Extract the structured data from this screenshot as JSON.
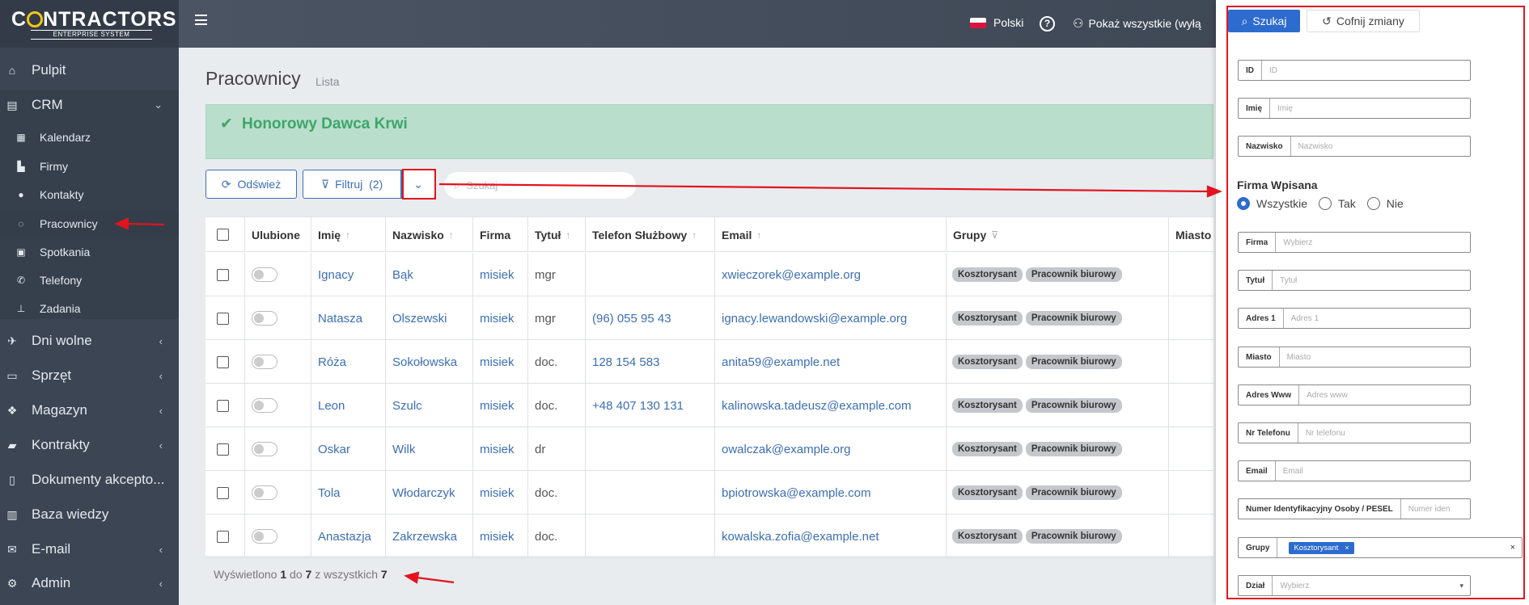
{
  "brand": {
    "name_pre": "C",
    "name_post": "NTRACTORS",
    "subtitle": "ENTERPRISE SYSTEM"
  },
  "sidebar": {
    "items": [
      {
        "label": "Pulpit",
        "icon": "home-icon"
      },
      {
        "label": "CRM",
        "icon": "address-card-icon",
        "arrow": "⌄"
      },
      {
        "label": "Dni wolne",
        "icon": "plane-icon",
        "arrow": "‹"
      },
      {
        "label": "Sprzęt",
        "icon": "hdd-icon",
        "arrow": "‹"
      },
      {
        "label": "Magazyn",
        "icon": "cubes-icon",
        "arrow": "‹"
      },
      {
        "label": "Kontrakty",
        "icon": "briefcase-icon",
        "arrow": "‹"
      },
      {
        "label": "Dokumenty akcepto...",
        "icon": "file-icon"
      },
      {
        "label": "Baza wiedzy",
        "icon": "book-icon"
      },
      {
        "label": "E-mail",
        "icon": "envelope-icon",
        "arrow": "‹"
      },
      {
        "label": "Admin",
        "icon": "cogs-icon",
        "arrow": "‹"
      }
    ],
    "crm_sub": [
      {
        "label": "Kalendarz",
        "icon": "calendar-icon"
      },
      {
        "label": "Firmy",
        "icon": "industry-icon"
      },
      {
        "label": "Kontakty",
        "icon": "user-icon"
      },
      {
        "label": "Pracownicy",
        "icon": "lemon-icon"
      },
      {
        "label": "Spotkania",
        "icon": "calendar-check-icon"
      },
      {
        "label": "Telefony",
        "icon": "phone-icon"
      },
      {
        "label": "Zadania",
        "icon": "thumbtack-icon"
      }
    ]
  },
  "topbar": {
    "language": "Polski",
    "help": "?",
    "user_toggle": "Pokaż wszystkie (wyłą"
  },
  "page": {
    "title": "Pracownicy",
    "subtitle": "Lista"
  },
  "alert": {
    "text": "Honorowy Dawca Krwi"
  },
  "toolbar": {
    "refresh_label": "Odśwież",
    "filter_label": "Filtruj  (2)",
    "dropdown_icon": "⌄",
    "search_placeholder": "Szukaj"
  },
  "table": {
    "headers": [
      "Ulubione",
      "Imię",
      "Nazwisko",
      "Firma",
      "Tytuł",
      "Telefon Służbowy",
      "Email",
      "Grupy",
      "Miasto"
    ],
    "rows": [
      {
        "first": "Ignacy",
        "last": "Bąk",
        "company": "misiek",
        "title": "mgr",
        "phone": "",
        "email": "xwieczorek@example.org",
        "groups": [
          "Kosztorysant",
          "Pracownik biurowy"
        ]
      },
      {
        "first": "Natasza",
        "last": "Olszewski",
        "company": "misiek",
        "title": "mgr",
        "phone": "(96) 055 95 43",
        "email": "ignacy.lewandowski@example.org",
        "groups": [
          "Kosztorysant",
          "Pracownik biurowy"
        ]
      },
      {
        "first": "Róża",
        "last": "Sokołowska",
        "company": "misiek",
        "title": "doc.",
        "phone": "128 154 583",
        "email": "anita59@example.net",
        "groups": [
          "Kosztorysant",
          "Pracownik biurowy"
        ]
      },
      {
        "first": "Leon",
        "last": "Szulc",
        "company": "misiek",
        "title": "doc.",
        "phone": "+48 407 130 131",
        "email": "kalinowska.tadeusz@example.com",
        "groups": [
          "Kosztorysant",
          "Pracownik biurowy"
        ]
      },
      {
        "first": "Oskar",
        "last": "Wilk",
        "company": "misiek",
        "title": "dr",
        "phone": "",
        "email": "owalczak@example.org",
        "groups": [
          "Kosztorysant",
          "Pracownik biurowy"
        ]
      },
      {
        "first": "Tola",
        "last": "Włodarczyk",
        "company": "misiek",
        "title": "doc.",
        "phone": "",
        "email": "bpiotrowska@example.com",
        "groups": [
          "Kosztorysant",
          "Pracownik biurowy"
        ]
      },
      {
        "first": "Anastazja",
        "last": "Zakrzewska",
        "company": "misiek",
        "title": "doc.",
        "phone": "",
        "email": "kowalska.zofia@example.net",
        "groups": [
          "Kosztorysant",
          "Pracownik biurowy"
        ]
      }
    ],
    "footer": {
      "pre": "Wyświetlono",
      "from": "1",
      "mid": "do",
      "to": "7",
      "mid2": "z wszystkich",
      "total": "7"
    }
  },
  "filter_panel": {
    "search_label": "Szukaj",
    "reset_label": "Cofnij zmiany",
    "fields_top": [
      {
        "label": "ID",
        "placeholder": "ID"
      },
      {
        "label": "Imię",
        "placeholder": "Imię"
      },
      {
        "label": "Nazwisko",
        "placeholder": "Nazwisko"
      }
    ],
    "section_title": "Firma Wpisana",
    "radios": [
      "Wszystkie",
      "Tak",
      "Nie"
    ],
    "fields_bottom": [
      {
        "label": "Firma",
        "placeholder": "Wybierz"
      },
      {
        "label": "Tytuł",
        "placeholder": "Tytuł"
      },
      {
        "label": "Adres 1",
        "placeholder": "Adres 1"
      },
      {
        "label": "Miasto",
        "placeholder": "Miasto"
      },
      {
        "label": "Adres Www",
        "placeholder": "Adres www"
      },
      {
        "label": "Nr Telefonu",
        "placeholder": "Nr telefonu"
      },
      {
        "label": "Email",
        "placeholder": "Email"
      },
      {
        "label": "Numer Identyfikacyjny Osoby / PESEL",
        "placeholder": "Numer iden"
      }
    ],
    "groups_label": "Grupy",
    "groups_chip": "Kosztorysant",
    "chip_remove": "×",
    "groups_clear": "×",
    "dept_label": "Dział",
    "dept_placeholder": "Wybierz",
    "dept_caret": "▾"
  },
  "colors": {
    "sidebar": "#3b4553",
    "accent": "#2d6bcf",
    "alert_bg": "#b9dfcc",
    "alert_text": "#3ea56a",
    "annotation": "#e3131e"
  }
}
